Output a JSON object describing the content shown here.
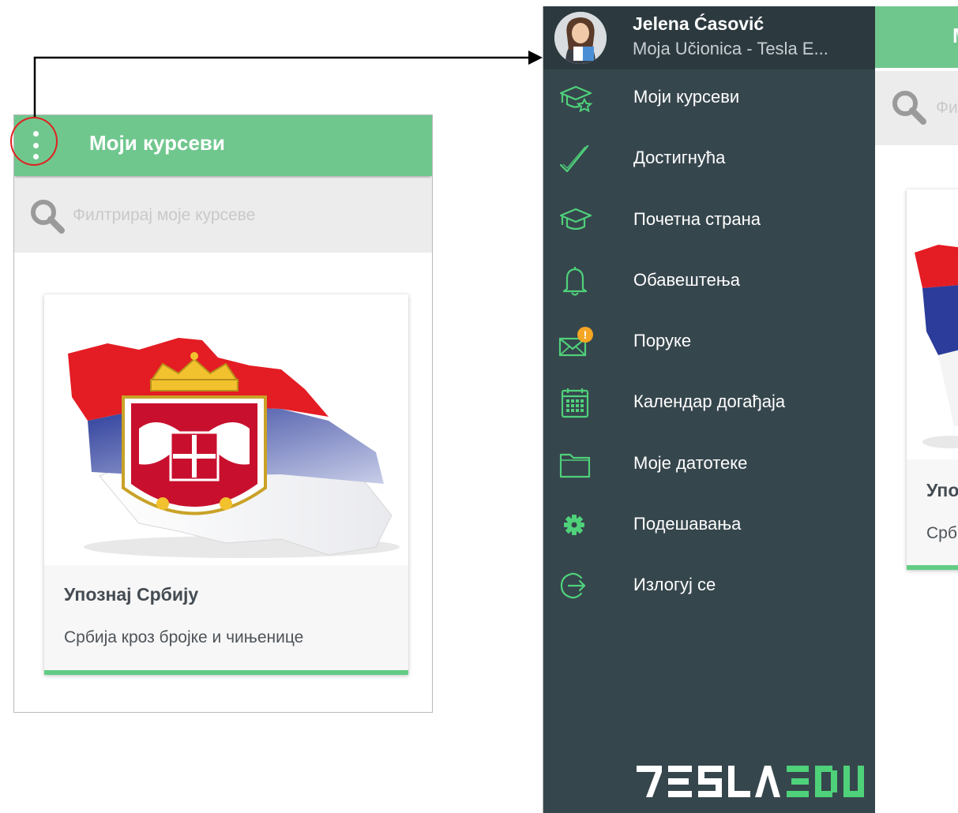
{
  "left_screen": {
    "header": {
      "title": "Моји курсеви",
      "menu_icon": "more-vertical-icon"
    },
    "search": {
      "placeholder": "Филтрирај моје курсеве",
      "icon": "search-icon"
    },
    "course": {
      "title": "Упознај Србију",
      "subtitle": "Србија кроз бројке и чињенице",
      "image": "serbia-map-flag-image"
    }
  },
  "right_screen": {
    "drawer": {
      "user_name": "Jelena Ćasović",
      "user_school": "Moja Učionica - Tesla E...",
      "items": [
        {
          "label": "Моји курсеви",
          "icon": "graduation-star-icon"
        },
        {
          "label": "Достигнућа",
          "icon": "checkmark-icon"
        },
        {
          "label": "Почетна страна",
          "icon": "graduation-cap-icon"
        },
        {
          "label": "Обавештења",
          "icon": "bell-icon"
        },
        {
          "label": "Поруке",
          "icon": "mail-alert-icon",
          "badge": "!"
        },
        {
          "label": "Календар догађаја",
          "icon": "calendar-icon"
        },
        {
          "label": "Моје датотеке",
          "icon": "folder-icon"
        },
        {
          "label": "Подешавања",
          "icon": "gear-icon"
        },
        {
          "label": "Излогуј се",
          "icon": "logout-icon"
        }
      ],
      "logo": "TESLAEDU"
    },
    "background": {
      "title_fragment": "М",
      "search_fragment": "Фи",
      "course_title_fragment": "Упо",
      "course_subtitle_fragment": "Срб"
    }
  },
  "colors": {
    "header_green": "#70c78e",
    "drawer_bg": "#36464d",
    "drawer_header_bg": "#2c3a40",
    "icon_green": "#4fd17a",
    "highlight_red": "#e02020",
    "badge_orange": "#f5a623"
  }
}
